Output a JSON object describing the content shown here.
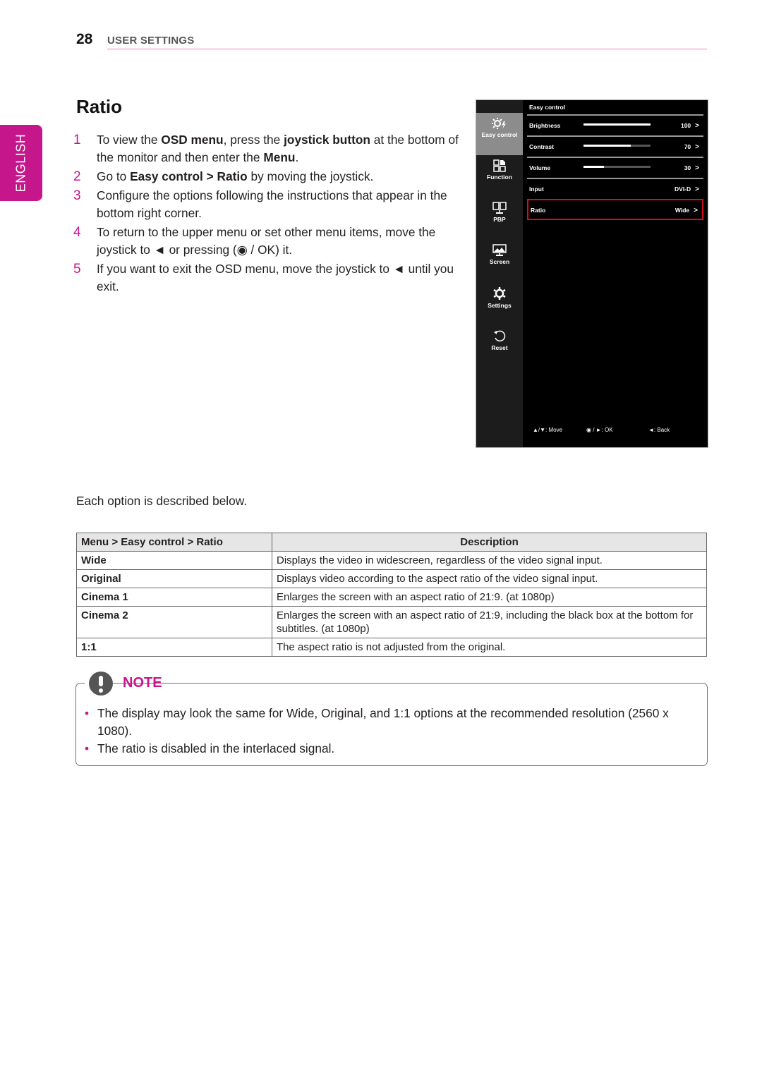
{
  "header": {
    "page_number": "28",
    "section": "USER SETTINGS"
  },
  "language_tab": "ENGLISH",
  "title": "Ratio",
  "steps": [
    {
      "num": "1",
      "parts": [
        [
          "To view the ",
          0
        ],
        [
          "OSD menu",
          1
        ],
        [
          ", press the ",
          0
        ],
        [
          "joystick button",
          1
        ],
        [
          " at the bottom of the monitor and then enter the ",
          0
        ],
        [
          "Menu",
          1
        ],
        [
          ".",
          0
        ]
      ]
    },
    {
      "num": "2",
      "parts": [
        [
          "Go to ",
          0
        ],
        [
          "Easy control > Ratio",
          1
        ],
        [
          " by moving the joystick.",
          0
        ]
      ]
    },
    {
      "num": "3",
      "parts": [
        [
          "Configure the options following the instructions that appear in the bottom right corner.",
          0
        ]
      ]
    },
    {
      "num": "4",
      "parts": [
        [
          "To return to the upper menu or set other menu items, move the joystick to ◄ or pressing (◉ / OK) it.",
          0
        ]
      ]
    },
    {
      "num": "5",
      "parts": [
        [
          "If you want to exit the OSD menu, move the joystick to ◄ until you exit.",
          0
        ]
      ]
    }
  ],
  "osd": {
    "sidebar": [
      {
        "label": "Easy control",
        "icon": "easy-control-icon",
        "active": true
      },
      {
        "label": "Function",
        "icon": "function-icon",
        "active": false
      },
      {
        "label": "PBP",
        "icon": "pbp-icon",
        "active": false
      },
      {
        "label": "Screen",
        "icon": "screen-icon",
        "active": false
      },
      {
        "label": "Settings",
        "icon": "settings-icon",
        "active": false
      },
      {
        "label": "Reset",
        "icon": "reset-icon",
        "active": false
      }
    ],
    "heading": "Easy control",
    "rows": [
      {
        "label": "Brightness",
        "value": "100",
        "level": 100,
        "arrow": ">"
      },
      {
        "label": "Contrast",
        "value": "70",
        "level": 70,
        "arrow": ">"
      },
      {
        "label": "Volume",
        "value": "30",
        "level": 30,
        "arrow": ">"
      },
      {
        "label": "Input",
        "value": "DVI-D",
        "arrow": ">"
      },
      {
        "label": "Ratio",
        "value": "Wide",
        "arrow": ">",
        "selected": true
      }
    ],
    "footer": {
      "move": "▲/▼: Move",
      "ok": "◉ / ►: OK",
      "back": "◄: Back"
    },
    "highlight_color": "#d0101c"
  },
  "description_intro": "Each option is described below.",
  "table": {
    "headers": [
      "Menu > Easy control > Ratio",
      "Description"
    ],
    "rows": [
      [
        "Wide",
        "Displays the video in widescreen, regardless of the video signal input."
      ],
      [
        "Original",
        "Displays video according to the aspect ratio of the video signal input."
      ],
      [
        "Cinema 1",
        "Enlarges the screen with an aspect ratio of 21:9. (at 1080p)"
      ],
      [
        "Cinema 2",
        "Enlarges the screen with an aspect ratio of 21:9, including the black box at the bottom for subtitles. (at 1080p)"
      ],
      [
        "1:1",
        "The aspect ratio is not adjusted from the original."
      ]
    ]
  },
  "note": {
    "title": "NOTE",
    "items": [
      "The display may look the same for Wide, Original, and 1:1 options at the recommended resolution (2560 x 1080).",
      "The ratio is disabled in the interlaced signal."
    ]
  },
  "colors": {
    "accent": "#c5168c",
    "rule": "#e97fbd"
  }
}
